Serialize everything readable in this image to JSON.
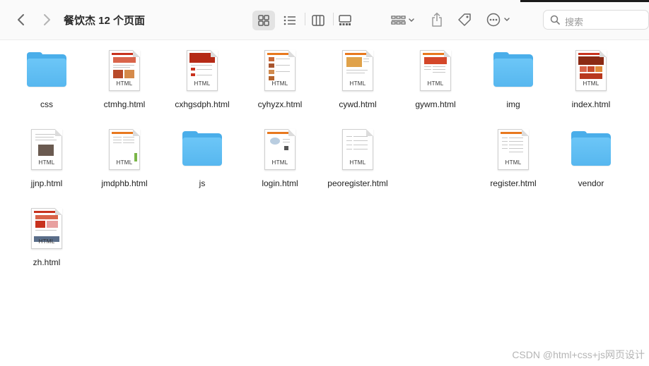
{
  "window": {
    "title": "餐饮杰 12 个页面"
  },
  "toolbar": {
    "search_placeholder": "搜索",
    "view_modes": [
      "icon-view",
      "list-view",
      "column-view",
      "gallery-view"
    ],
    "active_view": "icon-view"
  },
  "files": [
    {
      "name": "css",
      "kind": "folder"
    },
    {
      "name": "ctmhg.html",
      "kind": "html",
      "tag": "HTML"
    },
    {
      "name": "cxhgsdph.html",
      "kind": "html",
      "tag": "HTML"
    },
    {
      "name": "cyhyzx.html",
      "kind": "html",
      "tag": "HTML"
    },
    {
      "name": "cywd.html",
      "kind": "html",
      "tag": "HTML"
    },
    {
      "name": "gywm.html",
      "kind": "html",
      "tag": "HTML"
    },
    {
      "name": "img",
      "kind": "folder"
    },
    {
      "name": "index.html",
      "kind": "html",
      "tag": "HTML"
    },
    {
      "name": "jjnp.html",
      "kind": "html",
      "tag": "HTML"
    },
    {
      "name": "jmdphb.html",
      "kind": "html",
      "tag": "HTML"
    },
    {
      "name": "js",
      "kind": "folder"
    },
    {
      "name": "login.html",
      "kind": "html",
      "tag": "HTML"
    },
    {
      "name": "peoregister.html",
      "kind": "html",
      "tag": "HTML"
    },
    {
      "name": "register.html",
      "kind": "html",
      "tag": "HTML"
    },
    {
      "name": "vendor",
      "kind": "folder"
    },
    {
      "name": "zh.html",
      "kind": "html",
      "tag": "HTML"
    }
  ],
  "watermark": "CSDN @html+css+js网页设计",
  "colors": {
    "folder": "#57b7ef",
    "toolbar_bg": "#fafafa",
    "accent_red": "#c8321e",
    "accent_orange": "#e8781e"
  }
}
